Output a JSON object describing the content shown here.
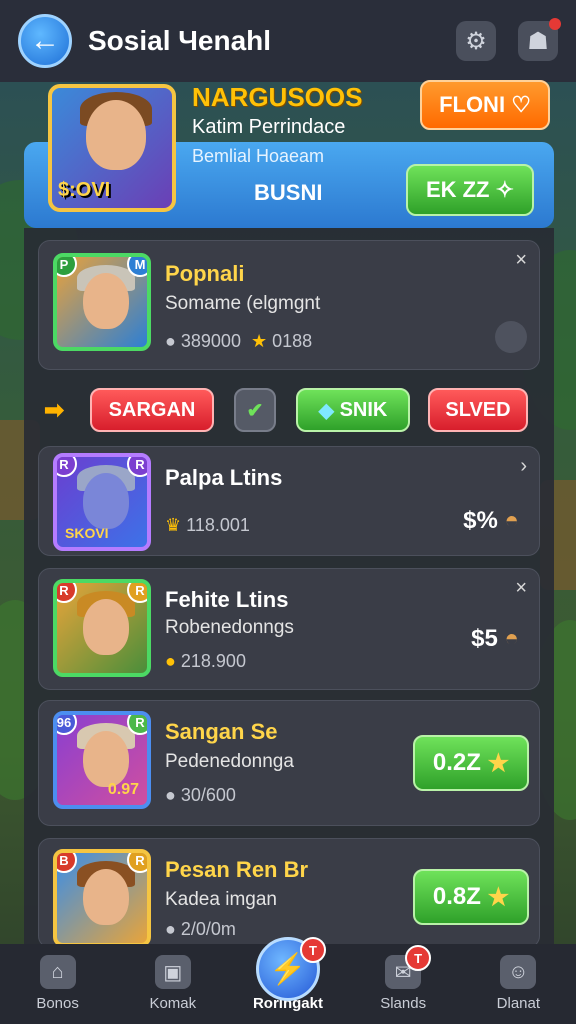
{
  "header": {
    "title": "Sosial Чenahl",
    "back_icon": "arrow-left-icon",
    "settings_icon": "gear-icon",
    "profile_icon": "controller-icon"
  },
  "featured": {
    "name": "NARGUSOOS",
    "subtitle": "Katim Perrindace",
    "subtitle2": "Bemlial Hoaeam",
    "price_label": "$:OVI",
    "center_label": "BUSNI",
    "btn_top": "FLONI",
    "btn_green": "EK ZZ"
  },
  "cards": [
    {
      "name": "Popnali",
      "sub": "Somame (elgmgnt",
      "stat1": "389000",
      "stat2": "0188",
      "badge_l": "P",
      "badge_r": "M",
      "close": "×"
    },
    {
      "name": "Palpa Ltins",
      "sub": "",
      "stat1": "118.001",
      "price": "$%",
      "badge_l": "R",
      "badge_r": "R",
      "close": "›",
      "portrait_text": "SKOVI"
    },
    {
      "name": "Fehite Ltins",
      "sub": "Robenedonngs",
      "stat1": "218.900",
      "price": "$5",
      "badge_l": "R",
      "badge_r": "R",
      "close": "×"
    },
    {
      "name": "Sangan Se",
      "sub": "Pedenedonnga",
      "stat1": "30/600",
      "button": "0.2Z",
      "badge_l": "96",
      "badge_r": "R",
      "portrait_text": "0.97"
    },
    {
      "name": "Pesan Ren Br",
      "sub": "Kadea imgan",
      "stat1": "2/0/0m",
      "button": "0.8Z",
      "badge_l": "B",
      "badge_r": "R"
    }
  ],
  "actions": {
    "red1": "SARGAN",
    "green": "SNIK",
    "red2": "SLVED"
  },
  "nav": [
    {
      "label": "Bonos",
      "icon": "home-icon"
    },
    {
      "label": "Komak",
      "icon": "cards-icon"
    },
    {
      "label": "Roringakt",
      "icon": "lightning-icon",
      "badge": "T"
    },
    {
      "label": "Slands",
      "icon": "chat-icon",
      "badge": "T"
    },
    {
      "label": "Dlanat",
      "icon": "user-icon"
    }
  ]
}
